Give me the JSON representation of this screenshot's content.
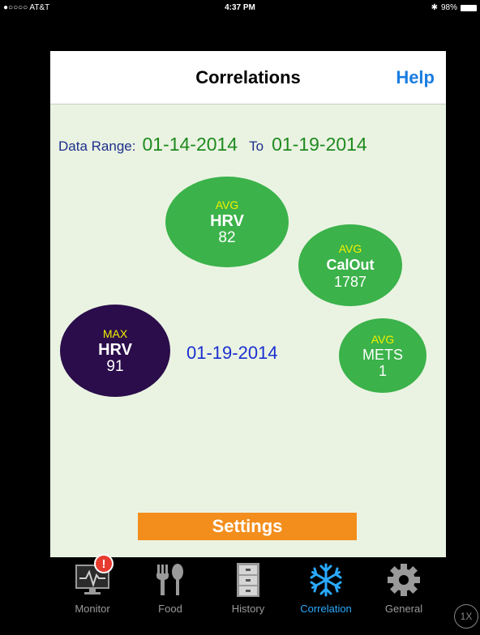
{
  "status_bar": {
    "carrier": "●○○○○ AT&T",
    "time": "4:37 PM",
    "battery": "98%"
  },
  "nav": {
    "title": "Correlations",
    "help": "Help"
  },
  "range": {
    "label": "Data Range:",
    "from": "01-14-2014",
    "to_label": "To",
    "to": "01-19-2014"
  },
  "bubbles": {
    "hrv_avg": {
      "tag": "AVG",
      "name": "HRV",
      "value": "82"
    },
    "calout_avg": {
      "tag": "AVG",
      "name": "CalOut",
      "value": "1787"
    },
    "hrv_max": {
      "tag": "MAX",
      "name": "HRV",
      "value": "91"
    },
    "mets_avg": {
      "tag": "AVG",
      "name": "METS",
      "value": "1"
    }
  },
  "selected_date": "01-19-2014",
  "settings_label": "Settings",
  "tabs": [
    {
      "label": "Monitor",
      "icon": "monitor-icon",
      "badge": "!"
    },
    {
      "label": "Food",
      "icon": "fork-spoon-icon"
    },
    {
      "label": "History",
      "icon": "file-cabinet-icon"
    },
    {
      "label": "Correlation",
      "icon": "snowflake-icon",
      "active": true
    },
    {
      "label": "General",
      "icon": "gear-icon"
    }
  ],
  "zoom_label": "1X",
  "colors": {
    "accent": "#1a7de0",
    "bubble_green": "#3bb24a",
    "bubble_dark": "#2a0d4a",
    "settings_orange": "#f38e1c",
    "tab_active": "#2aa9ff"
  }
}
